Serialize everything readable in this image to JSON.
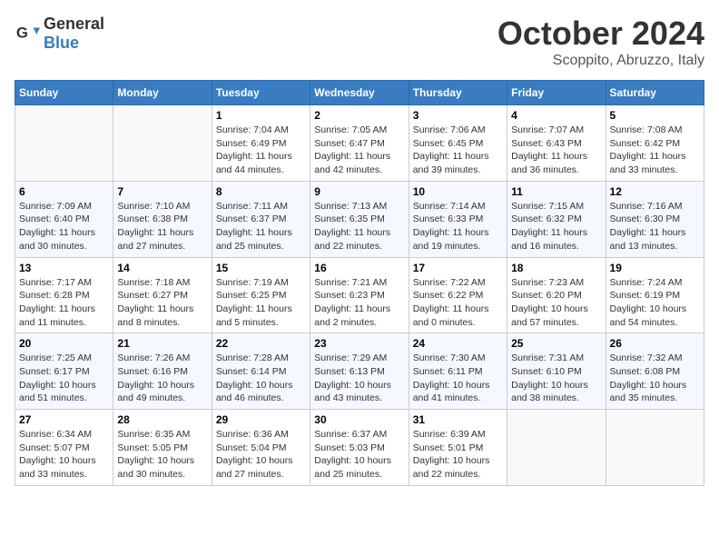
{
  "header": {
    "logo_general": "General",
    "logo_blue": "Blue",
    "month": "October 2024",
    "location": "Scoppito, Abruzzo, Italy"
  },
  "days_of_week": [
    "Sunday",
    "Monday",
    "Tuesday",
    "Wednesday",
    "Thursday",
    "Friday",
    "Saturday"
  ],
  "weeks": [
    [
      {
        "day": "",
        "info": ""
      },
      {
        "day": "",
        "info": ""
      },
      {
        "day": "1",
        "info": "Sunrise: 7:04 AM\nSunset: 6:49 PM\nDaylight: 11 hours and 44 minutes."
      },
      {
        "day": "2",
        "info": "Sunrise: 7:05 AM\nSunset: 6:47 PM\nDaylight: 11 hours and 42 minutes."
      },
      {
        "day": "3",
        "info": "Sunrise: 7:06 AM\nSunset: 6:45 PM\nDaylight: 11 hours and 39 minutes."
      },
      {
        "day": "4",
        "info": "Sunrise: 7:07 AM\nSunset: 6:43 PM\nDaylight: 11 hours and 36 minutes."
      },
      {
        "day": "5",
        "info": "Sunrise: 7:08 AM\nSunset: 6:42 PM\nDaylight: 11 hours and 33 minutes."
      }
    ],
    [
      {
        "day": "6",
        "info": "Sunrise: 7:09 AM\nSunset: 6:40 PM\nDaylight: 11 hours and 30 minutes."
      },
      {
        "day": "7",
        "info": "Sunrise: 7:10 AM\nSunset: 6:38 PM\nDaylight: 11 hours and 27 minutes."
      },
      {
        "day": "8",
        "info": "Sunrise: 7:11 AM\nSunset: 6:37 PM\nDaylight: 11 hours and 25 minutes."
      },
      {
        "day": "9",
        "info": "Sunrise: 7:13 AM\nSunset: 6:35 PM\nDaylight: 11 hours and 22 minutes."
      },
      {
        "day": "10",
        "info": "Sunrise: 7:14 AM\nSunset: 6:33 PM\nDaylight: 11 hours and 19 minutes."
      },
      {
        "day": "11",
        "info": "Sunrise: 7:15 AM\nSunset: 6:32 PM\nDaylight: 11 hours and 16 minutes."
      },
      {
        "day": "12",
        "info": "Sunrise: 7:16 AM\nSunset: 6:30 PM\nDaylight: 11 hours and 13 minutes."
      }
    ],
    [
      {
        "day": "13",
        "info": "Sunrise: 7:17 AM\nSunset: 6:28 PM\nDaylight: 11 hours and 11 minutes."
      },
      {
        "day": "14",
        "info": "Sunrise: 7:18 AM\nSunset: 6:27 PM\nDaylight: 11 hours and 8 minutes."
      },
      {
        "day": "15",
        "info": "Sunrise: 7:19 AM\nSunset: 6:25 PM\nDaylight: 11 hours and 5 minutes."
      },
      {
        "day": "16",
        "info": "Sunrise: 7:21 AM\nSunset: 6:23 PM\nDaylight: 11 hours and 2 minutes."
      },
      {
        "day": "17",
        "info": "Sunrise: 7:22 AM\nSunset: 6:22 PM\nDaylight: 11 hours and 0 minutes."
      },
      {
        "day": "18",
        "info": "Sunrise: 7:23 AM\nSunset: 6:20 PM\nDaylight: 10 hours and 57 minutes."
      },
      {
        "day": "19",
        "info": "Sunrise: 7:24 AM\nSunset: 6:19 PM\nDaylight: 10 hours and 54 minutes."
      }
    ],
    [
      {
        "day": "20",
        "info": "Sunrise: 7:25 AM\nSunset: 6:17 PM\nDaylight: 10 hours and 51 minutes."
      },
      {
        "day": "21",
        "info": "Sunrise: 7:26 AM\nSunset: 6:16 PM\nDaylight: 10 hours and 49 minutes."
      },
      {
        "day": "22",
        "info": "Sunrise: 7:28 AM\nSunset: 6:14 PM\nDaylight: 10 hours and 46 minutes."
      },
      {
        "day": "23",
        "info": "Sunrise: 7:29 AM\nSunset: 6:13 PM\nDaylight: 10 hours and 43 minutes."
      },
      {
        "day": "24",
        "info": "Sunrise: 7:30 AM\nSunset: 6:11 PM\nDaylight: 10 hours and 41 minutes."
      },
      {
        "day": "25",
        "info": "Sunrise: 7:31 AM\nSunset: 6:10 PM\nDaylight: 10 hours and 38 minutes."
      },
      {
        "day": "26",
        "info": "Sunrise: 7:32 AM\nSunset: 6:08 PM\nDaylight: 10 hours and 35 minutes."
      }
    ],
    [
      {
        "day": "27",
        "info": "Sunrise: 6:34 AM\nSunset: 5:07 PM\nDaylight: 10 hours and 33 minutes."
      },
      {
        "day": "28",
        "info": "Sunrise: 6:35 AM\nSunset: 5:05 PM\nDaylight: 10 hours and 30 minutes."
      },
      {
        "day": "29",
        "info": "Sunrise: 6:36 AM\nSunset: 5:04 PM\nDaylight: 10 hours and 27 minutes."
      },
      {
        "day": "30",
        "info": "Sunrise: 6:37 AM\nSunset: 5:03 PM\nDaylight: 10 hours and 25 minutes."
      },
      {
        "day": "31",
        "info": "Sunrise: 6:39 AM\nSunset: 5:01 PM\nDaylight: 10 hours and 22 minutes."
      },
      {
        "day": "",
        "info": ""
      },
      {
        "day": "",
        "info": ""
      }
    ]
  ]
}
